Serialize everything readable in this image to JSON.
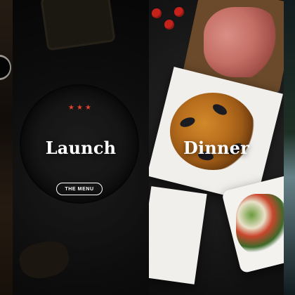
{
  "panels": {
    "launch": {
      "stars": "★★★",
      "title": "Launch",
      "button_label": "THE MENU"
    },
    "dinner": {
      "title": "Dinner"
    }
  },
  "colors": {
    "star_accent": "#e0422f",
    "text": "#ffffff"
  }
}
